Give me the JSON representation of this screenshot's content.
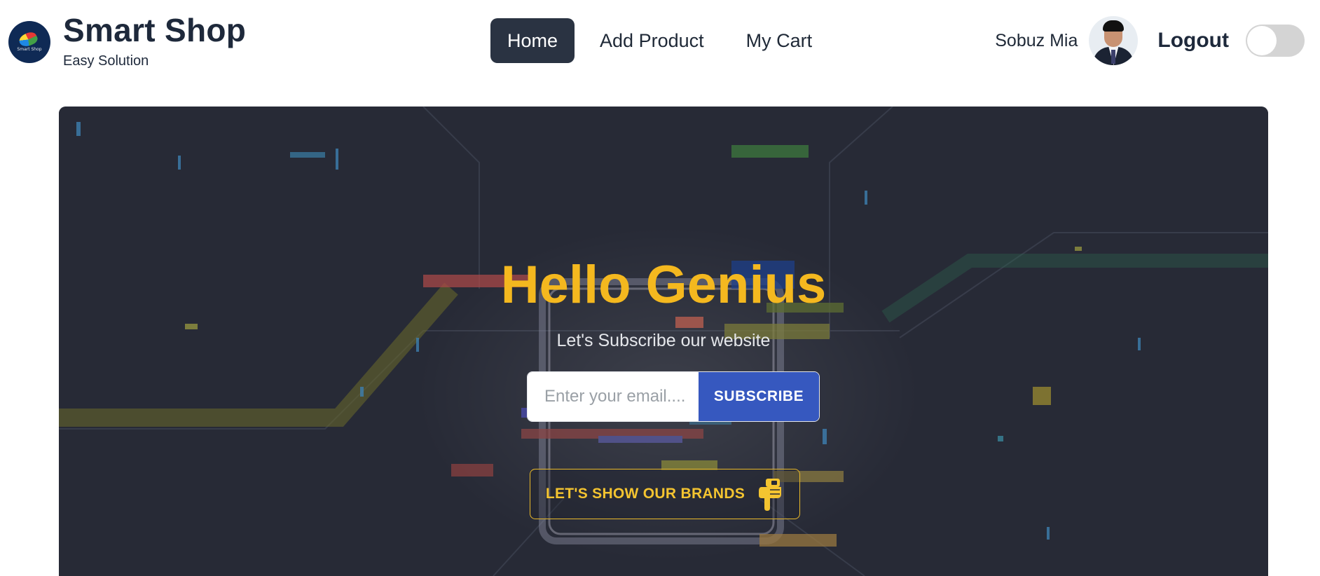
{
  "brand": {
    "title": "Smart Shop",
    "subtitle": "Easy Solution",
    "logo_text": "Smart Shop"
  },
  "nav": {
    "links": [
      {
        "label": "Home",
        "active": true
      },
      {
        "label": "Add Product",
        "active": false
      },
      {
        "label": "My Cart",
        "active": false
      }
    ]
  },
  "user": {
    "name": "Sobuz Mia",
    "logout_label": "Logout",
    "theme_toggle_on": false
  },
  "hero": {
    "title": "Hello Genius",
    "subtitle": "Let's Subscribe our website",
    "email_placeholder": "Enter your email....",
    "subscribe_label": "SUBSCRIBE",
    "brands_label": "LET'S SHOW OUR BRANDS",
    "brands_icon": "hand-pointing-down-icon"
  },
  "colors": {
    "title_accent": "#f4b81f",
    "subscribe_button": "#3658bf",
    "active_nav": "#2a3342",
    "hero_background": "#272a36"
  }
}
